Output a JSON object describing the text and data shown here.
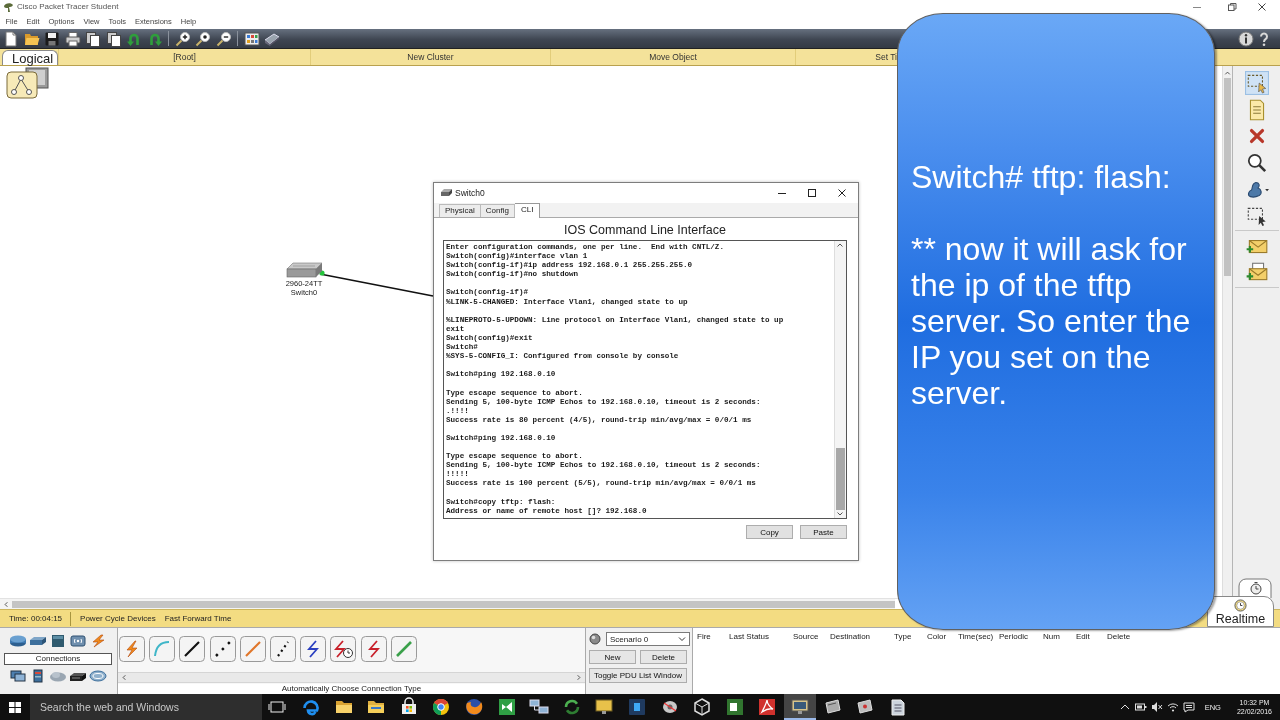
{
  "window": {
    "title": "Cisco Packet Tracer Student"
  },
  "menu": [
    "File",
    "Edit",
    "Options",
    "View",
    "Tools",
    "Extensions",
    "Help"
  ],
  "workspace_bar": {
    "mode_tab": "Logical",
    "items": [
      "[Root]",
      "New Cluster",
      "Move Object",
      "Set Ti"
    ]
  },
  "tool_palette": [
    {
      "selected": true
    },
    {
      "selected": false
    },
    {
      "selected": false
    },
    {
      "selected": false
    },
    {
      "selected": false
    },
    {
      "selected": false
    },
    {
      "selected": false
    },
    {
      "selected": false
    }
  ],
  "canvas": {
    "devices": [
      {
        "model": "2960-24TT",
        "name": "Switch0"
      }
    ],
    "links": [
      {
        "up": true
      }
    ]
  },
  "device_dialog": {
    "title": "Switch0",
    "tabs": [
      {
        "label": "Physical",
        "selected": false
      },
      {
        "label": "Config",
        "selected": false
      },
      {
        "label": "CLI",
        "selected": true
      }
    ],
    "heading": "IOS Command Line Interface",
    "output": [
      [
        "Enter configuration commands, one per line.  End with CNTL/Z.",
        "Switch(config)#interface vlan 1",
        "Switch(config-if)#ip address 192.168.0.1 255.255.255.0",
        "Switch(config-if)#no shutdown"
      ],
      [
        "Switch(config-if)#",
        "%LINK-5-CHANGED: Interface Vlan1, changed state to up"
      ],
      [
        "%LINEPROTO-5-UPDOWN: Line protocol on Interface Vlan1, changed state to up",
        "exit",
        "Switch(config)#exit",
        "Switch#",
        "%SYS-5-CONFIG_I: Configured from console by console"
      ],
      [
        "Switch#ping 192.168.0.10"
      ],
      [
        "Type escape sequence to abort.",
        "Sending 5, 100-byte ICMP Echos to 192.168.0.10, timeout is 2 seconds:",
        ".!!!!",
        "Success rate is 80 percent (4/5), round-trip min/avg/max = 0/0/1 ms"
      ],
      [
        "Switch#ping 192.168.0.10"
      ],
      [
        "Type escape sequence to abort.",
        "Sending 5, 100-byte ICMP Echos to 192.168.0.10, timeout is 2 seconds:",
        "!!!!!",
        "Success rate is 100 percent (5/5), round-trip min/avg/max = 0/0/1 ms"
      ],
      [
        "Switch#copy tftp: flash:",
        "Address or name of remote host []? 192.168.0"
      ]
    ],
    "buttons": [
      "Copy",
      "Paste"
    ]
  },
  "callout": {
    "paragraphs": [
      "Switch# tftp: flash:",
      "** now it will ask for the ip of the tftp server. So enter the IP you set on the server."
    ]
  },
  "status_bar": {
    "time": "Time: 00:04:15",
    "buttons": [
      "Power Cycle Devices",
      "Fast Forward Time"
    ],
    "mode_tab": "Realtime"
  },
  "device_panel": {
    "category": "Connections",
    "connection_caption": "Automatically Choose Connection Type"
  },
  "scenario_panel": {
    "scenario": "Scenario 0",
    "buttons": [
      "New",
      "Delete"
    ],
    "toggle_button": "Toggle PDU List Window"
  },
  "pdu_list": {
    "columns": [
      "Fire",
      "Last Status",
      "Source",
      "Destination",
      "Type",
      "Color",
      "Time(sec)",
      "Periodic",
      "Num",
      "Edit",
      "Delete"
    ]
  },
  "taskbar": {
    "search_placeholder": "Search the web and Windows",
    "apps": [
      {
        "selected": false
      },
      {
        "selected": false
      },
      {
        "selected": false
      },
      {
        "selected": false
      },
      {
        "selected": false
      },
      {
        "selected": false
      },
      {
        "selected": false
      },
      {
        "selected": false
      },
      {
        "selected": false
      },
      {
        "selected": false
      },
      {
        "selected": false
      },
      {
        "selected": false
      },
      {
        "selected": false
      },
      {
        "selected": false
      },
      {
        "selected": false
      },
      {
        "selected": true
      },
      {
        "selected": false
      },
      {
        "selected": false
      },
      {
        "selected": false
      }
    ],
    "language": "ENG",
    "time": "10:32 PM",
    "date": "22/02/2016"
  }
}
